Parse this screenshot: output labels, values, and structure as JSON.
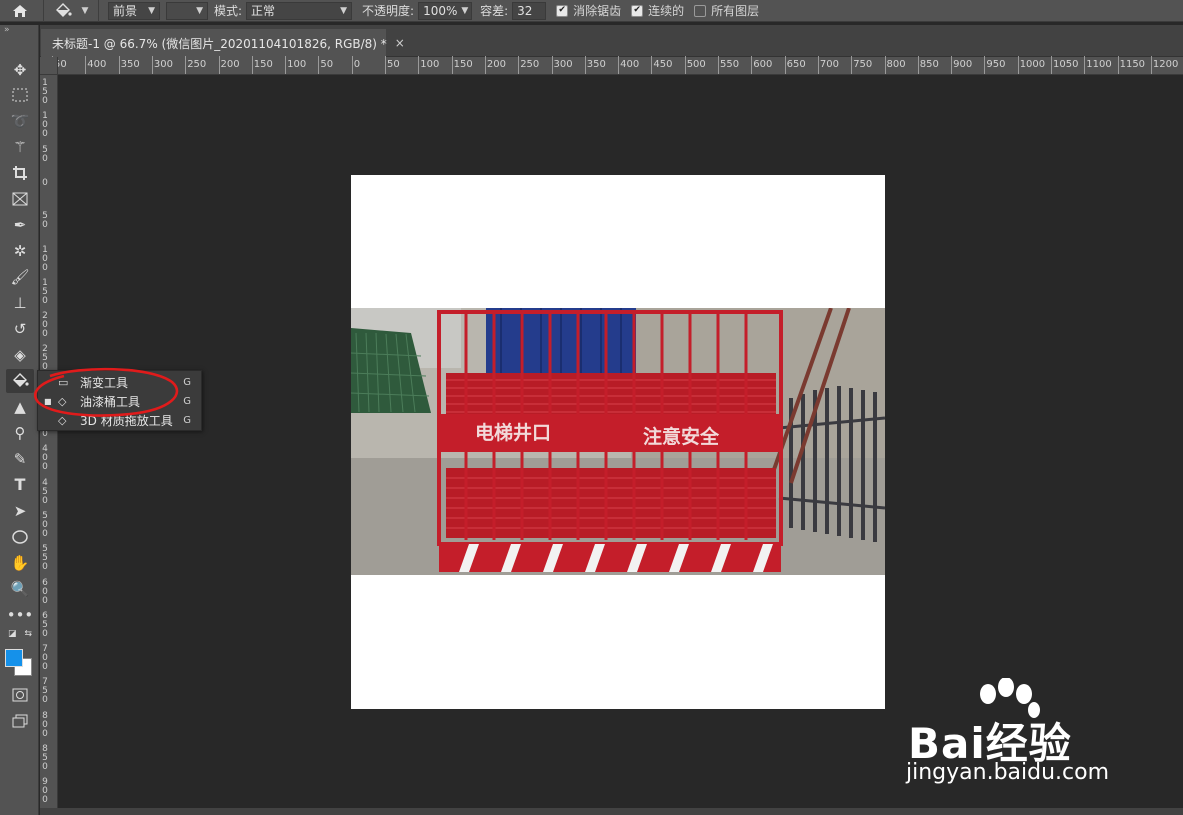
{
  "options_bar": {
    "preset_icon": "paint-bucket-icon",
    "fill_source": "前景",
    "mode_label": "模式:",
    "mode_value": "正常",
    "opacity_label": "不透明度:",
    "opacity_value": "100%",
    "tolerance_label": "容差:",
    "tolerance_value": "32",
    "anti_alias_label": "消除锯齿",
    "anti_alias_checked": true,
    "contiguous_label": "连续的",
    "contiguous_checked": true,
    "all_layers_label": "所有图层",
    "all_layers_checked": false
  },
  "document_tab": {
    "title": "未标题-1 @ 66.7% (微信图片_20201104101826, RGB/8) *",
    "close_glyph": "×"
  },
  "ruler": {
    "h_labels": [
      "50",
      "400",
      "350",
      "300",
      "250",
      "200",
      "150",
      "100",
      "50",
      "0",
      "50",
      "100",
      "150",
      "200",
      "250",
      "300",
      "350",
      "400",
      "450",
      "500",
      "550",
      "600",
      "650",
      "700",
      "750",
      "800",
      "850",
      "900",
      "950",
      "1000",
      "1050",
      "1100",
      "1150",
      "1200"
    ],
    "v_labels": [
      "150",
      "100",
      "50",
      "0",
      "50",
      "100",
      "150",
      "200",
      "250",
      "300",
      "350",
      "400",
      "450",
      "500",
      "550",
      "600",
      "650",
      "700",
      "750",
      "800",
      "850",
      "900"
    ]
  },
  "toolbar": {
    "tools": [
      "move-icon",
      "marquee-icon",
      "lasso-icon",
      "magic-wand-icon",
      "crop-icon",
      "frame-icon",
      "eyedropper-icon",
      "spot-healing-icon",
      "brush-icon",
      "clone-stamp-icon",
      "history-brush-icon",
      "eraser-icon",
      "paint-bucket-icon",
      "blur-icon",
      "dodge-icon",
      "pen-icon",
      "type-icon",
      "path-selection-icon",
      "ellipse-icon",
      "hand-icon",
      "zoom-icon",
      "more-icon",
      "quick-mask-icon",
      "screen-mode-icon"
    ],
    "foreground_color": "#1591ea",
    "background_color": "#ffffff"
  },
  "flyout": {
    "items": [
      {
        "label": "渐变工具",
        "shortcut": "G",
        "icon": "gradient-icon"
      },
      {
        "label": "油漆桶工具",
        "shortcut": "G",
        "icon": "paint-bucket-icon",
        "selected": true
      },
      {
        "label": "3D 材质拖放工具",
        "shortcut": "G",
        "icon": "3d-material-drop-icon"
      }
    ]
  },
  "photo": {
    "sign_left": "电梯井口",
    "sign_right": "注意安全"
  },
  "watermark": {
    "logo": "Bai经验",
    "url": "jingyan.baidu.com"
  },
  "colors": {
    "annotation_ellipse": "#e01b1b",
    "fence_red": "#c41e2a"
  }
}
